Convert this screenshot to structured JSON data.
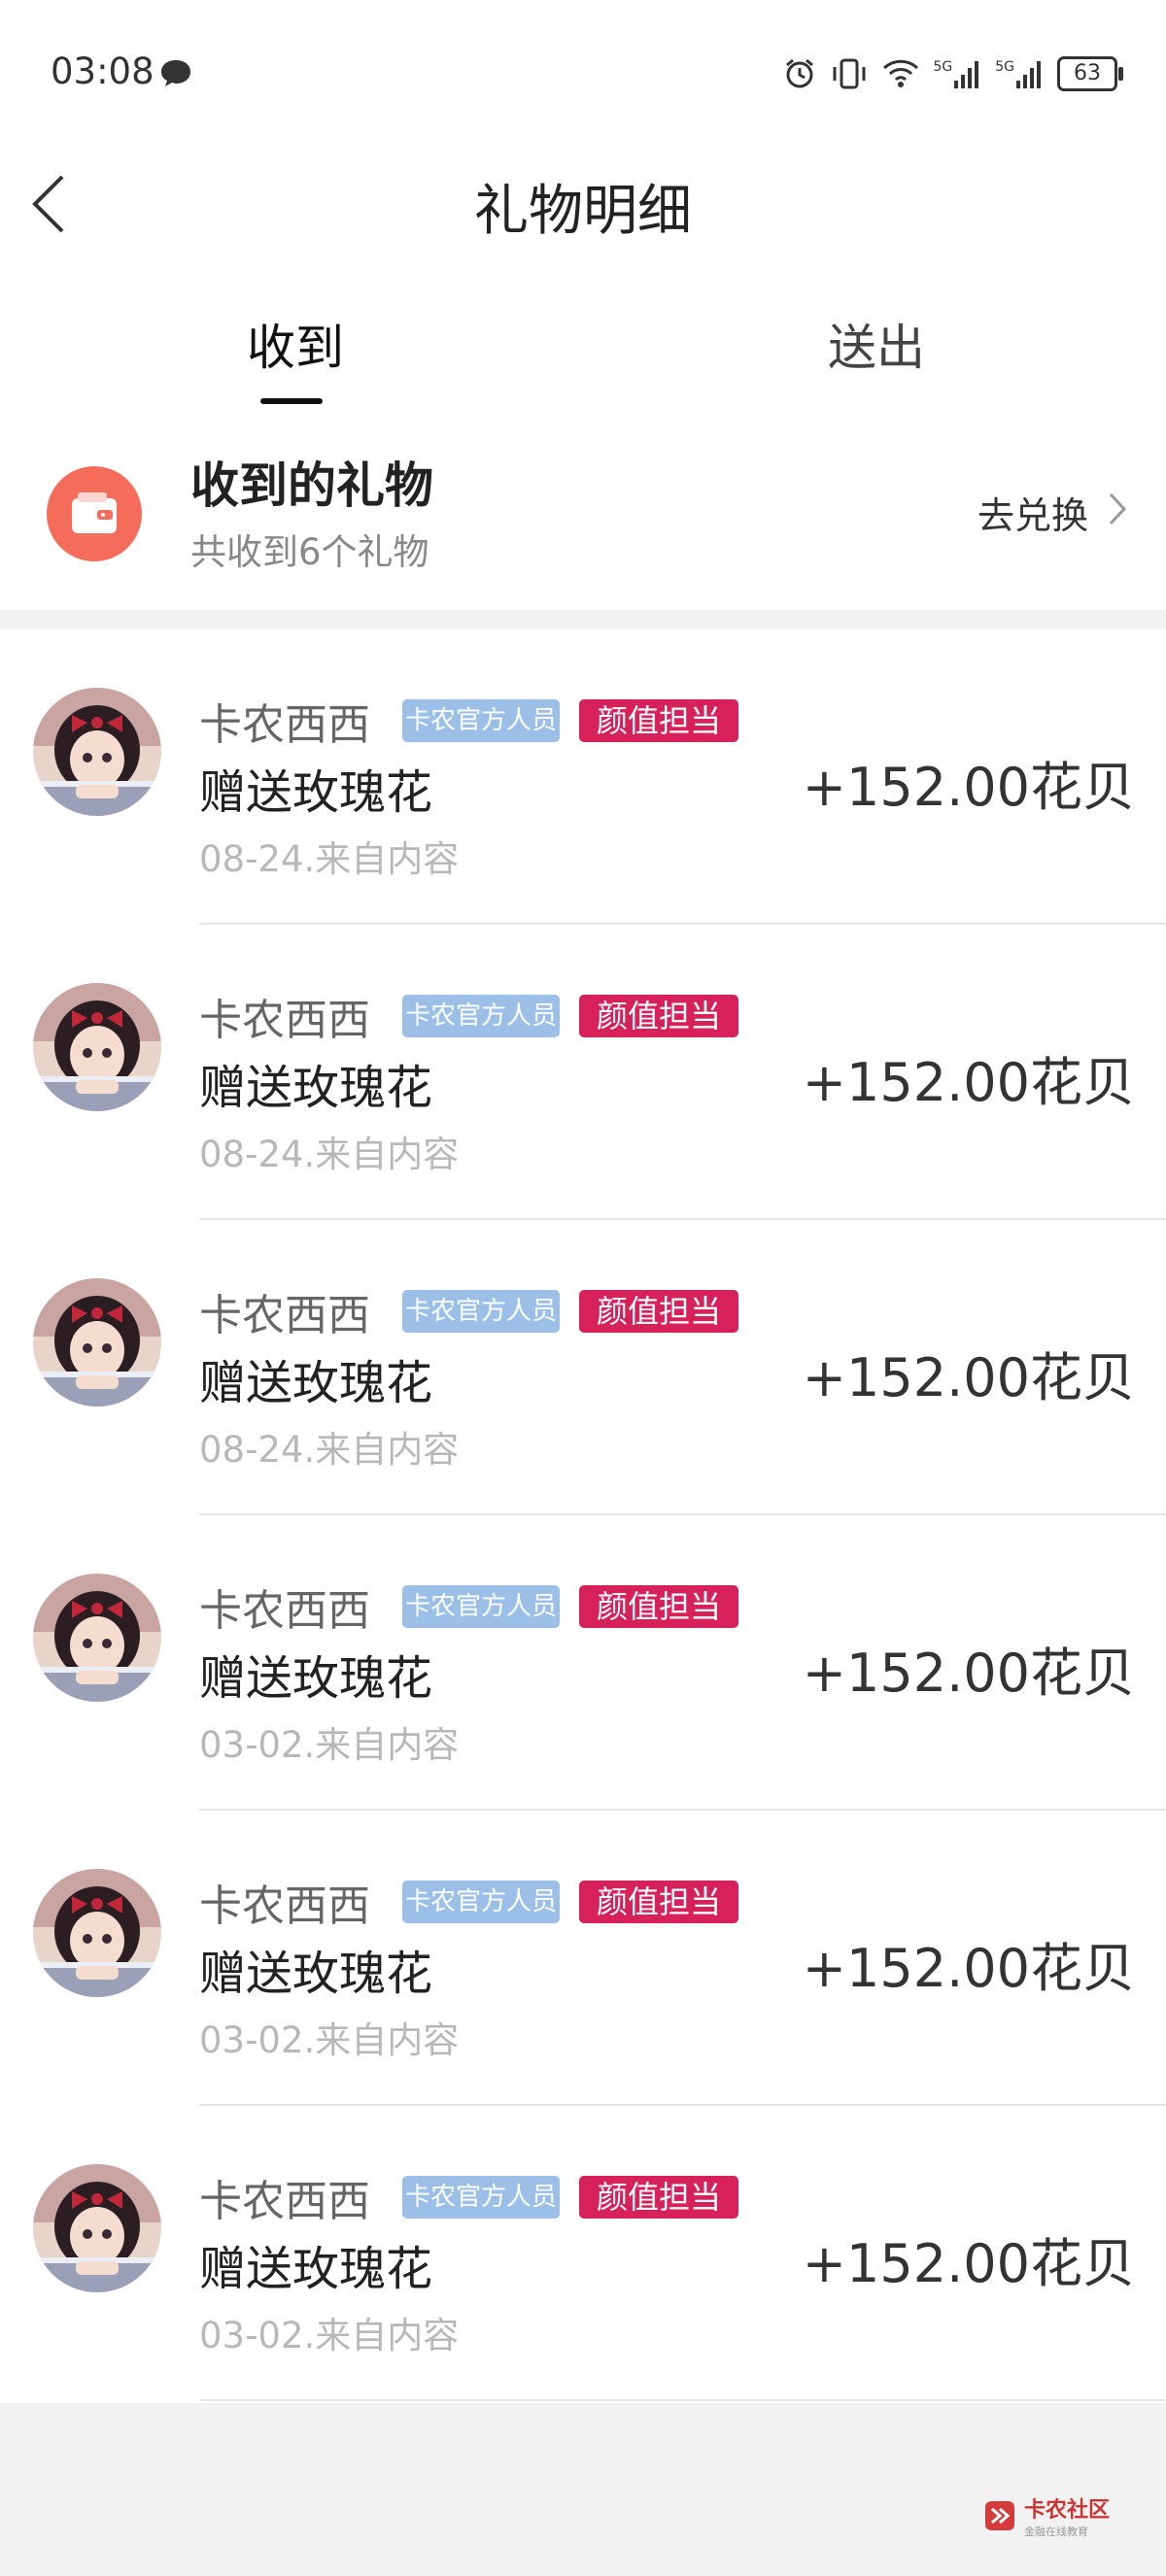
{
  "status_bar": {
    "time": "03:08",
    "network1": "5G",
    "network2": "5G",
    "battery": "63"
  },
  "header": {
    "title": "礼物明细"
  },
  "tabs": [
    {
      "label": "收到"
    },
    {
      "label": "送出"
    }
  ],
  "summary": {
    "title": "收到的礼物",
    "subtitle": "共收到6个礼物",
    "exchange_label": "去兑换"
  },
  "items": [
    {
      "name": "卡农西西",
      "badge_official": "卡农官方人员",
      "badge_looks": "颜值担当",
      "gift": "赠送玫瑰花",
      "meta": "08-24.来自内容",
      "amount": "+152.00花贝"
    },
    {
      "name": "卡农西西",
      "badge_official": "卡农官方人员",
      "badge_looks": "颜值担当",
      "gift": "赠送玫瑰花",
      "meta": "08-24.来自内容",
      "amount": "+152.00花贝"
    },
    {
      "name": "卡农西西",
      "badge_official": "卡农官方人员",
      "badge_looks": "颜值担当",
      "gift": "赠送玫瑰花",
      "meta": "08-24.来自内容",
      "amount": "+152.00花贝"
    },
    {
      "name": "卡农西西",
      "badge_official": "卡农官方人员",
      "badge_looks": "颜值担当",
      "gift": "赠送玫瑰花",
      "meta": "03-02.来自内容",
      "amount": "+152.00花贝"
    },
    {
      "name": "卡农西西",
      "badge_official": "卡农官方人员",
      "badge_looks": "颜值担当",
      "gift": "赠送玫瑰花",
      "meta": "03-02.来自内容",
      "amount": "+152.00花贝"
    },
    {
      "name": "卡农西西",
      "badge_official": "卡农官方人员",
      "badge_looks": "颜值担当",
      "gift": "赠送玫瑰花",
      "meta": "03-02.来自内容",
      "amount": "+152.00花贝"
    }
  ],
  "watermark": {
    "text": "卡农社区",
    "sub": "金融在线教育"
  },
  "colors": {
    "accent_red": "#d6215a",
    "official_blue": "#9cbfe8",
    "wallet": "#f66c5a"
  }
}
